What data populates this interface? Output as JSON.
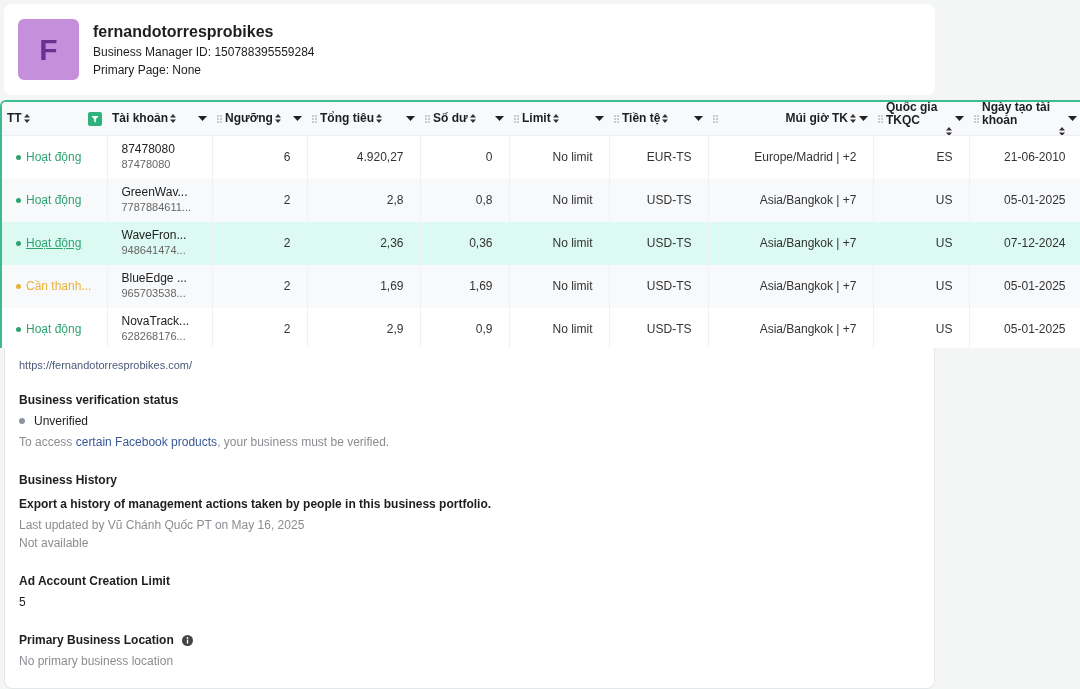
{
  "business": {
    "avatar_letter": "F",
    "name": "fernandotorresprobikes",
    "manager_id": "Business Manager ID: 150788395559284",
    "primary_page": "Primary Page: None"
  },
  "table": {
    "columns": [
      "TT",
      "Tài khoản",
      "Ngưỡng",
      "Tổng tiêu",
      "Số dư",
      "Limit",
      "Tiền tệ",
      "Múi giờ TK",
      "Quốc gia TKQC",
      "Ngày tạo tài khoản"
    ],
    "rows": [
      {
        "status": {
          "label": "Hoạt động",
          "kind": "active"
        },
        "account_name": "87478080",
        "account_id": "87478080",
        "threshold": "6",
        "total_spend": "4.920,27",
        "balance": "0",
        "limit": "No limit",
        "currency": "EUR-TS",
        "timezone": "Europe/Madrid | +2",
        "country": "ES",
        "created": "21-06-2010",
        "selected": false
      },
      {
        "status": {
          "label": "Hoạt động",
          "kind": "active"
        },
        "account_name": "GreenWav...",
        "account_id": "7787884611...",
        "threshold": "2",
        "total_spend": "2,8",
        "balance": "0,8",
        "limit": "No limit",
        "currency": "USD-TS",
        "timezone": "Asia/Bangkok | +7",
        "country": "US",
        "created": "05-01-2025",
        "selected": false
      },
      {
        "status": {
          "label": "Hoạt động",
          "kind": "active"
        },
        "account_name": "WaveFron...",
        "account_id": "948641474...",
        "threshold": "2",
        "total_spend": "2,36",
        "balance": "0,36",
        "limit": "No limit",
        "currency": "USD-TS",
        "timezone": "Asia/Bangkok | +7",
        "country": "US",
        "created": "07-12-2024",
        "selected": true
      },
      {
        "status": {
          "label": "Cần thanh...",
          "kind": "warning"
        },
        "account_name": "BlueEdge ...",
        "account_id": "965703538...",
        "threshold": "2",
        "total_spend": "1,69",
        "balance": "1,69",
        "limit": "No limit",
        "currency": "USD-TS",
        "timezone": "Asia/Bangkok | +7",
        "country": "US",
        "created": "05-01-2025",
        "selected": false
      },
      {
        "status": {
          "label": "Hoạt động",
          "kind": "active"
        },
        "account_name": "NovaTrack...",
        "account_id": "628268176...",
        "threshold": "2",
        "total_spend": "2,9",
        "balance": "0,9",
        "limit": "No limit",
        "currency": "USD-TS",
        "timezone": "Asia/Bangkok | +7",
        "country": "US",
        "created": "05-01-2025",
        "selected": false
      }
    ]
  },
  "details": {
    "website_url": "https://fernandotorresprobikes.com/",
    "verification": {
      "title": "Business verification status",
      "status": "Unverified",
      "note_before": "To access ",
      "note_link": "certain Facebook products",
      "note_after": ", your business must be verified."
    },
    "history": {
      "title": "Business History",
      "description": "Export a history of management actions taken by people in this business portfolio.",
      "updated": "Last updated by Vũ Chánh Quốc PT on May 16, 2025",
      "availability": "Not available"
    },
    "ad_limit": {
      "title": "Ad Account Creation Limit",
      "value": "5"
    },
    "location": {
      "title": "Primary Business Location",
      "value": "No primary business location"
    }
  }
}
